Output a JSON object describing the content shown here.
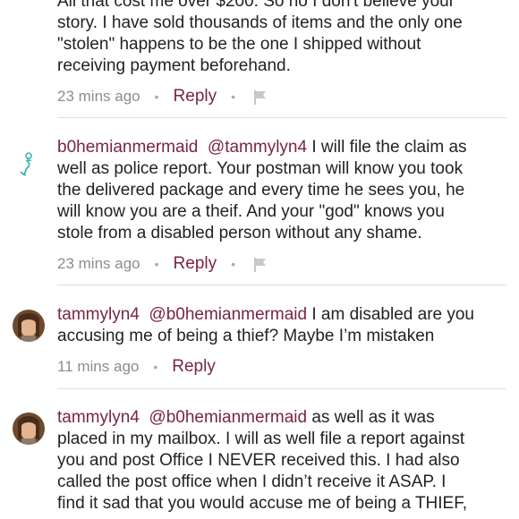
{
  "comments": [
    {
      "lines": [
        "All that cost me over $200. So no I don't believe your",
        "story. I have sold thousands of items and the only one",
        "\"stolen\" happens to be the one I shipped without",
        "receiving payment beforehand."
      ],
      "time": "23 mins ago",
      "reply_label": "Reply"
    },
    {
      "username": "b0hemianmermaid",
      "mention": "@tammylyn4",
      "first_line_rest": " I will file the claim as",
      "lines": [
        "well as police report. Your postman will know you took",
        "the delivered package and every time he sees you, he",
        "will know you are a theif. And your \"god\" knows you",
        "stole from a disabled person without any shame."
      ],
      "time": "23 mins ago",
      "reply_label": "Reply"
    },
    {
      "username": "tammylyn4",
      "mention": "@b0hemianmermaid",
      "first_line_rest": " I am disabled are you",
      "lines": [
        "accusing me of being a thief? Maybe I’m mistaken"
      ],
      "time": "11 mins ago",
      "reply_label": "Reply"
    },
    {
      "username": "tammylyn4",
      "mention": "@b0hemianmermaid",
      "first_line_rest": " as well as it was",
      "lines": [
        "placed in my mailbox. I will as well file a report against",
        "you and post Office I NEVER received this. I had also",
        "called the post office when I didn’t receive it ASAP. I",
        "find it sad that you would accuse me of being a THIEF,"
      ]
    }
  ],
  "colors": {
    "username": "#7a2540",
    "meta_gray": "#8c8c8c",
    "divider": "#dedede"
  },
  "icons": [
    "flag-icon",
    "mermaid-avatar",
    "avatar"
  ]
}
